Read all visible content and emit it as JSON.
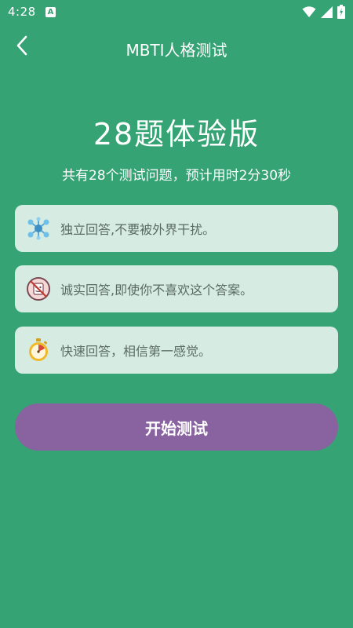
{
  "status_bar": {
    "time": "4:28",
    "notification_icon": "a-notification-icon",
    "right_icons": [
      "wifi-icon",
      "signal-icon",
      "battery-icon"
    ]
  },
  "app_bar": {
    "back_icon": "chevron-left-icon",
    "title": "MBTI人格测试"
  },
  "main": {
    "heading": "28题体验版",
    "subheading": "共有28个测试问题，预计用时2分30秒",
    "tips": [
      {
        "icon": "molecule-icon",
        "text": "独立回答,不要被外界干扰。"
      },
      {
        "icon": "no-pretend-icon",
        "text": "诚实回答,即使你不喜欢这个答案。"
      },
      {
        "icon": "stopwatch-icon",
        "text": "快速回答，相信第一感觉。"
      }
    ],
    "start_button_label": "开始测试"
  },
  "colors": {
    "background": "#35a374",
    "card": "#d6ece3",
    "button": "#8962a0",
    "text_on_card": "#5b6b64"
  }
}
